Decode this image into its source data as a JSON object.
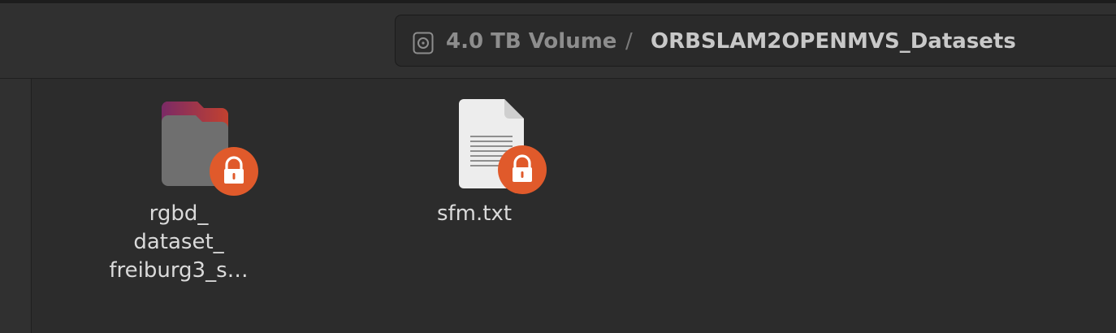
{
  "pathbar": {
    "volume_label": "4.0 TB Volume",
    "separator": "/",
    "current_folder": "ORBSLAM2OPENMVS_Datasets",
    "volume_icon": "drive-icon"
  },
  "items": [
    {
      "kind": "folder",
      "icon": "folder-icon",
      "badge": "lock-icon",
      "label_lines": [
        "rgbd_",
        "dataset_",
        "freiburg3_s…"
      ]
    },
    {
      "kind": "text-file",
      "icon": "text-file-icon",
      "badge": "lock-icon",
      "label_lines": [
        "sfm.txt"
      ]
    }
  ],
  "colors": {
    "badge": "#e05a2b",
    "folder_body": "#6f6f6f",
    "folder_tab": "#8e2a63"
  }
}
